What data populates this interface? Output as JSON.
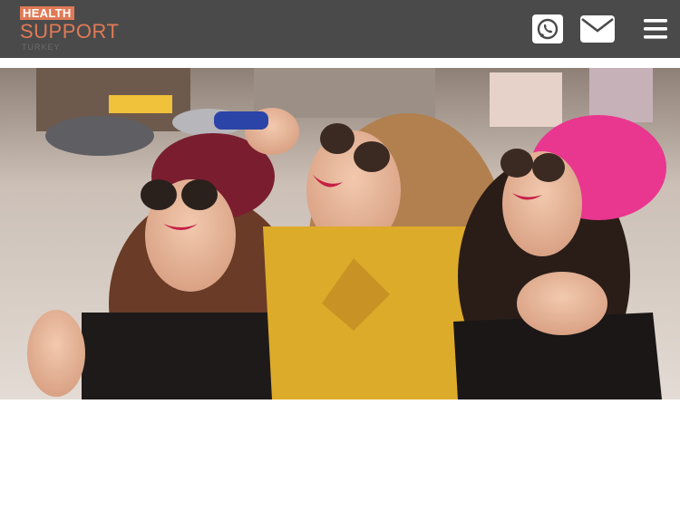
{
  "header": {
    "logo": {
      "line1": "HEALTH",
      "line2": "SUPPORT",
      "line3": "TURKEY"
    },
    "icons": {
      "whatsapp": "whatsapp-icon",
      "mail": "mail-icon",
      "menu": "hamburger-menu-icon"
    }
  },
  "colors": {
    "header_bg": "#4a4a4a",
    "brand_accent": "#e07a56",
    "page_bg": "#ffffff"
  },
  "hero": {
    "image": "three-women-laughing-photo"
  }
}
